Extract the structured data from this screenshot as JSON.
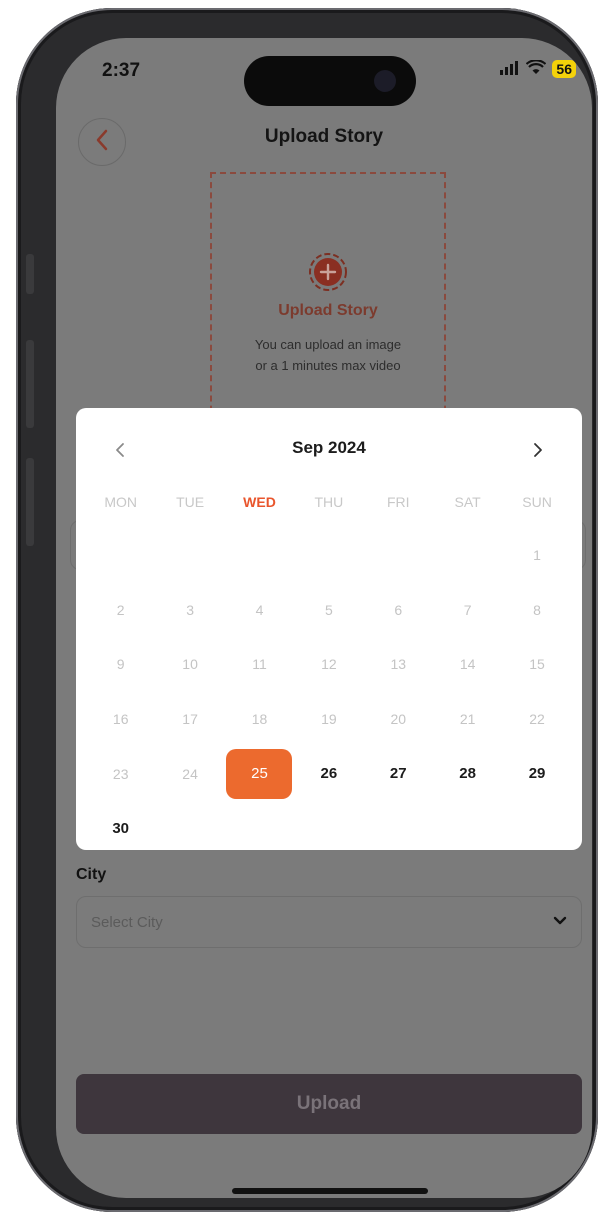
{
  "status_bar": {
    "time": "2:37",
    "battery": "56"
  },
  "header": {
    "title": "Upload Story"
  },
  "upload": {
    "label": "Upload Story",
    "desc_line1": "You can upload an image",
    "desc_line2": "or a 1 minutes max video"
  },
  "calendar": {
    "month_title": "Sep 2024",
    "weekdays": [
      "MON",
      "TUE",
      "WED",
      "THU",
      "FRI",
      "SAT",
      "SUN"
    ],
    "today_weekday": "WED",
    "selected_day": "25",
    "days": [
      "",
      "",
      "",
      "",
      "",
      "",
      "1",
      "2",
      "3",
      "4",
      "5",
      "6",
      "7",
      "8",
      "9",
      "10",
      "11",
      "12",
      "13",
      "14",
      "15",
      "16",
      "17",
      "18",
      "19",
      "20",
      "21",
      "22",
      "23",
      "24",
      "25",
      "26",
      "27",
      "28",
      "29",
      "30"
    ],
    "first_enabled_day": 25
  },
  "city": {
    "label": "City",
    "placeholder": "Select City"
  },
  "actions": {
    "upload_label": "Upload"
  },
  "colors": {
    "accent": "#ec6a2e",
    "button_bg": "#3e363d"
  }
}
